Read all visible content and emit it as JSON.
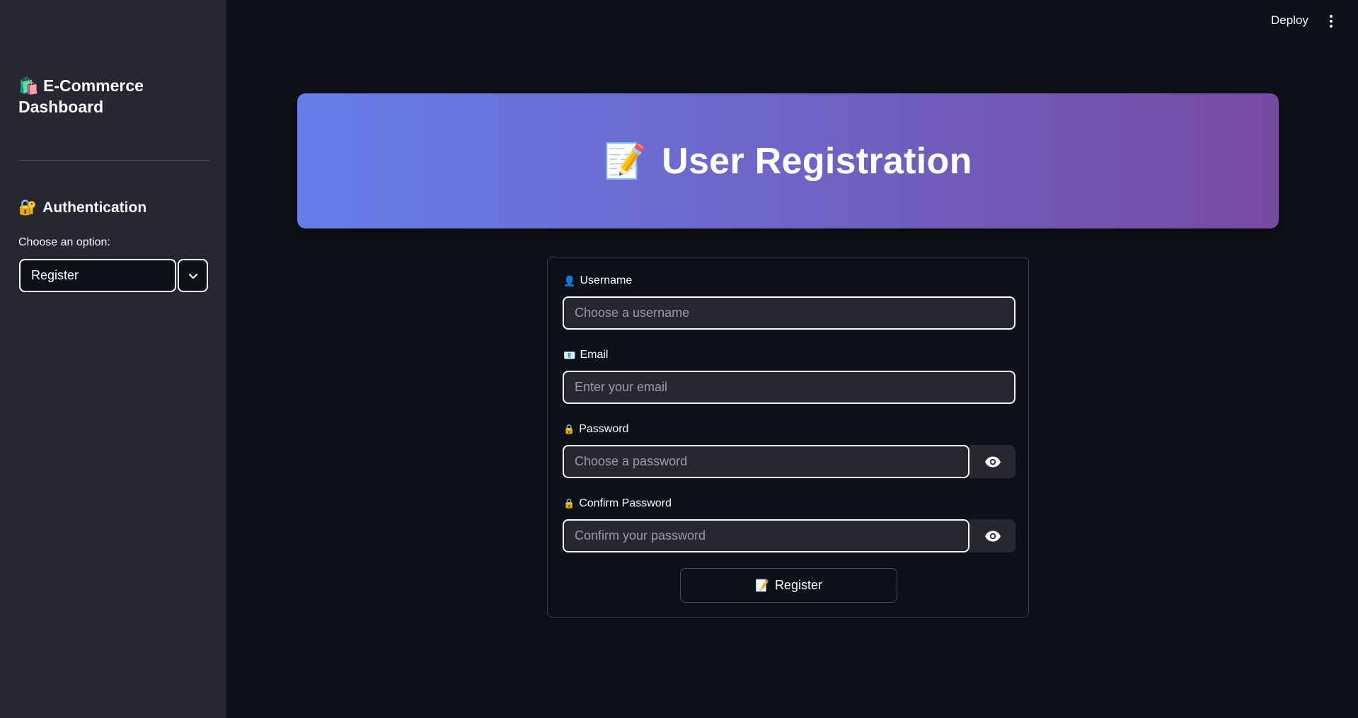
{
  "sidebar": {
    "title_emoji": "🛍️",
    "title": "E-Commerce Dashboard",
    "section_emoji": "🔐",
    "section_title": "Authentication",
    "select_label": "Choose an option:",
    "select_value": "Register"
  },
  "header": {
    "deploy_label": "Deploy"
  },
  "banner": {
    "emoji": "📝",
    "title": "User Registration"
  },
  "form": {
    "username": {
      "emoji": "👤",
      "label": "Username",
      "placeholder": "Choose a username"
    },
    "email": {
      "emoji": "📧",
      "label": "Email",
      "placeholder": "Enter your email"
    },
    "password": {
      "emoji": "🔒",
      "label": "Password",
      "placeholder": "Choose a password"
    },
    "confirm_password": {
      "emoji": "🔒",
      "label": "Confirm Password",
      "placeholder": "Confirm your password"
    },
    "submit": {
      "emoji": "📝",
      "label": "Register"
    }
  },
  "colors": {
    "background": "#0e1117",
    "sidebar": "#262730",
    "banner_start": "#667eea",
    "banner_end": "#764ba2"
  }
}
